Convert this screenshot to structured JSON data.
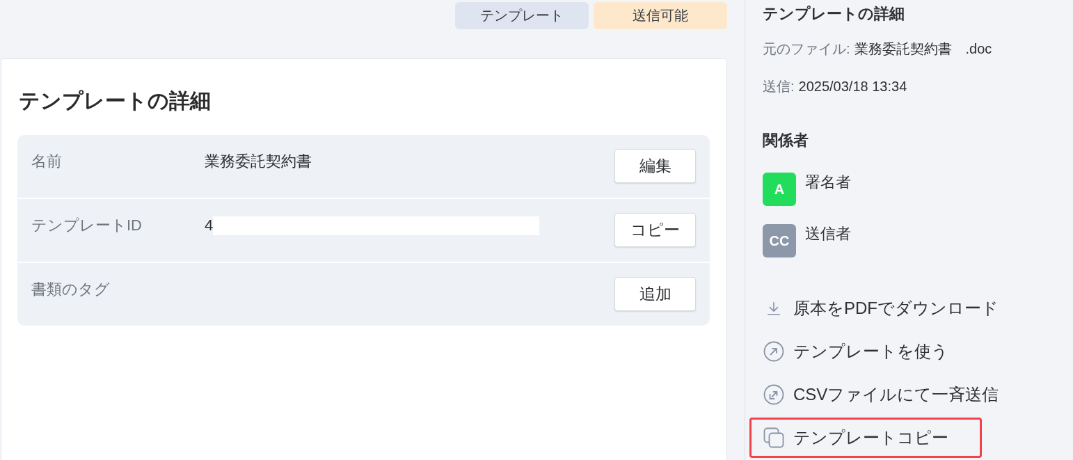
{
  "tags": [
    {
      "label": "テンプレート",
      "color": "#dfe5f0"
    },
    {
      "label": "送信可能",
      "color": "#fde8cc"
    }
  ],
  "details": {
    "title": "テンプレートの詳細",
    "rows": [
      {
        "label": "名前",
        "value": "業務委託契約書",
        "button": "編集"
      },
      {
        "label": "テンプレートID",
        "value": "4",
        "redacted": true,
        "button": "コピー"
      },
      {
        "label": "書類のタグ",
        "button": "追加"
      }
    ]
  },
  "sidebar": {
    "title": "テンプレートの詳細",
    "meta": [
      {
        "label": "元のファイル:",
        "value": "業務委託契約書　.doc"
      },
      {
        "label": "送信:",
        "value": "2025/03/18 13:34"
      }
    ],
    "participants_title": "関係者",
    "participants": [
      {
        "initials": "A",
        "name": "署名者",
        "color": "#22dd5c"
      },
      {
        "initials": "CC",
        "name": "送信者",
        "color": "#8c97aa"
      }
    ],
    "actions": [
      {
        "kind": "download",
        "label": "原本をPDFでダウンロード",
        "highlighted": false
      },
      {
        "kind": "open",
        "label": "テンプレートを使う",
        "highlighted": false
      },
      {
        "kind": "bulk",
        "label": "CSVファイルにて一斉送信",
        "highlighted": false
      },
      {
        "kind": "copy",
        "label": "テンプレートコピー",
        "highlighted": true
      }
    ]
  }
}
